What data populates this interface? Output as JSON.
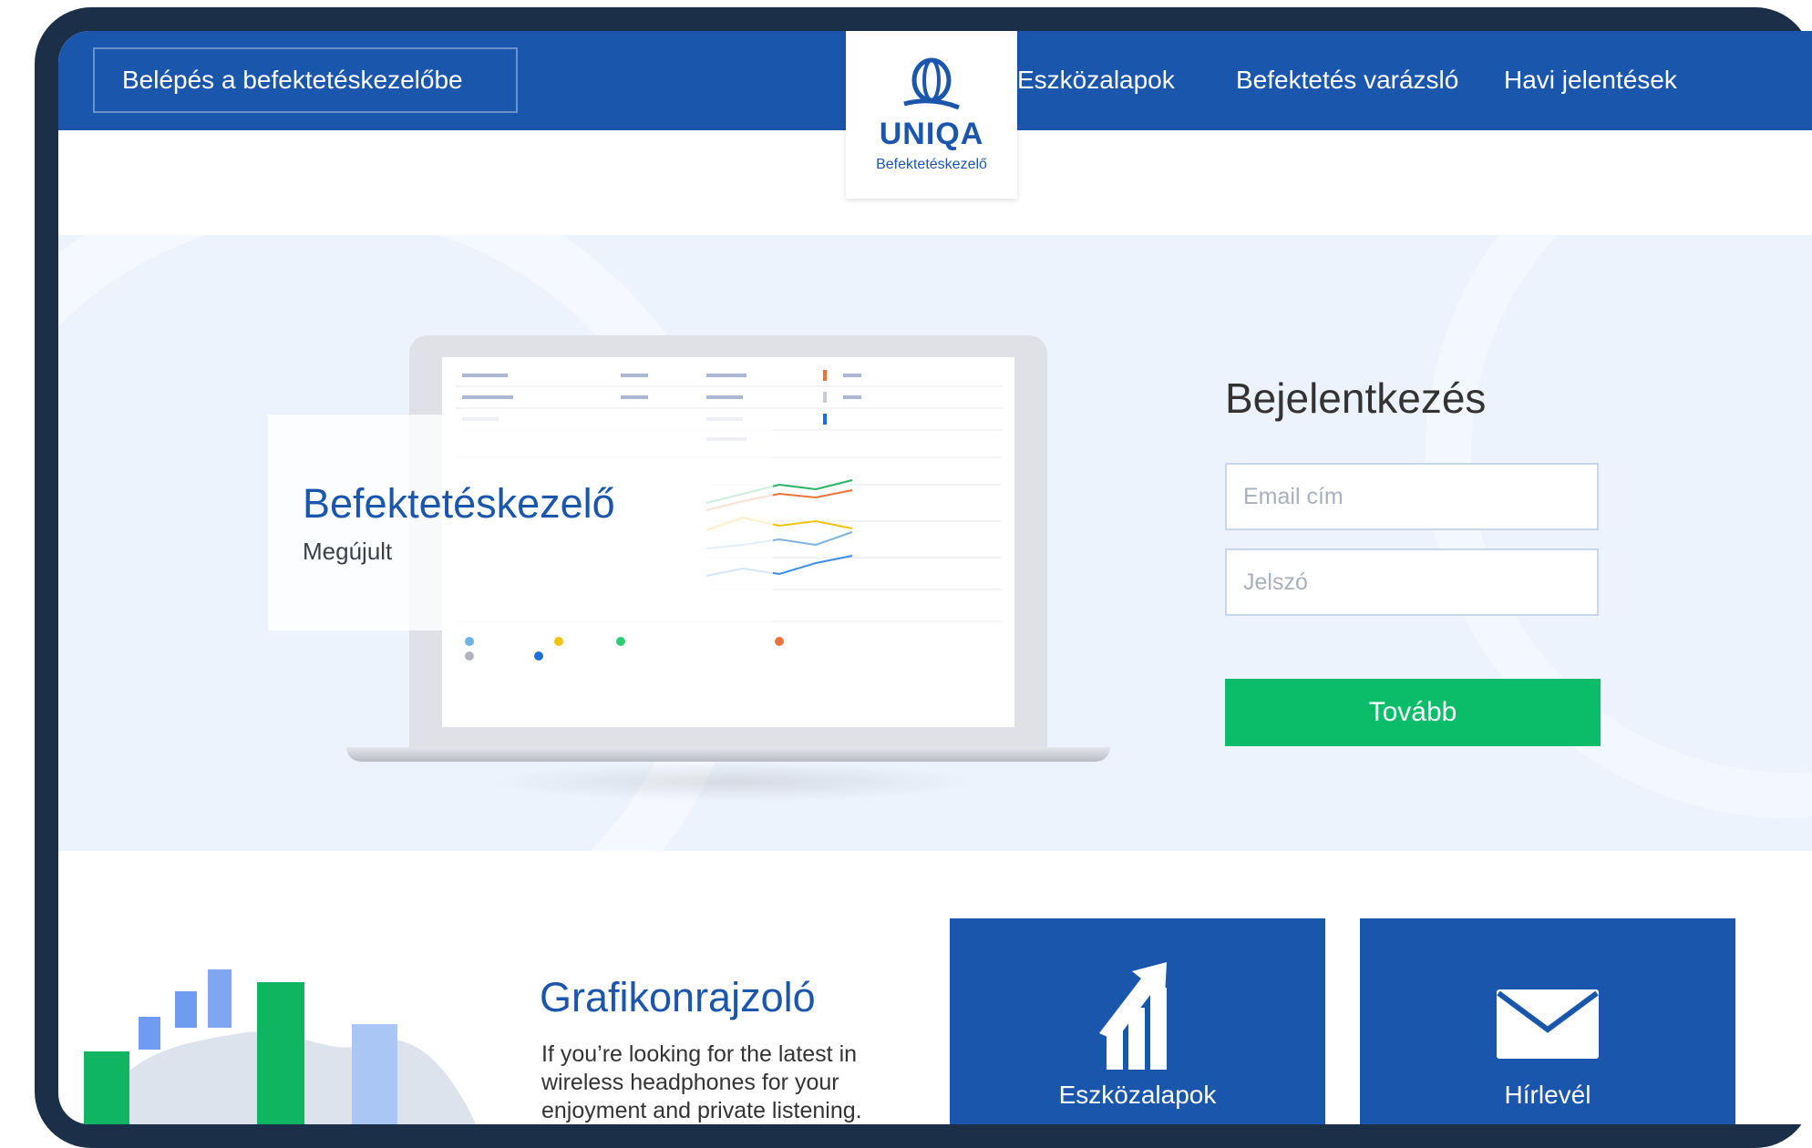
{
  "header": {
    "login_link": "Belépés a befektetéskezelőbe",
    "nav": [
      "Eszközalapok",
      "Befektetés varázsló",
      "Havi jelentések"
    ],
    "logo": {
      "name": "UNIQA",
      "subtitle": "Befektetéskezelő"
    }
  },
  "hero": {
    "title": "Befektetéskezelő",
    "subtitle": "Megújult"
  },
  "login": {
    "title": "Bejelentkezés",
    "email_placeholder": "Email cím",
    "password_placeholder": "Jelszó",
    "submit_label": "Tovább"
  },
  "features": {
    "chart_title": "Grafikonrajzoló",
    "chart_text": "If you’re looking for the latest in wireless headphones for your enjoyment and private listening.",
    "tiles": [
      {
        "label": "Eszközalapok",
        "icon": "growth-chart-icon"
      },
      {
        "label": "Hírlevél",
        "icon": "envelope-icon"
      }
    ]
  },
  "colors": {
    "primary": "#1b56ad",
    "accent": "#0bbd69",
    "hero_bg": "#edf3fd",
    "frame": "#1b3048"
  }
}
